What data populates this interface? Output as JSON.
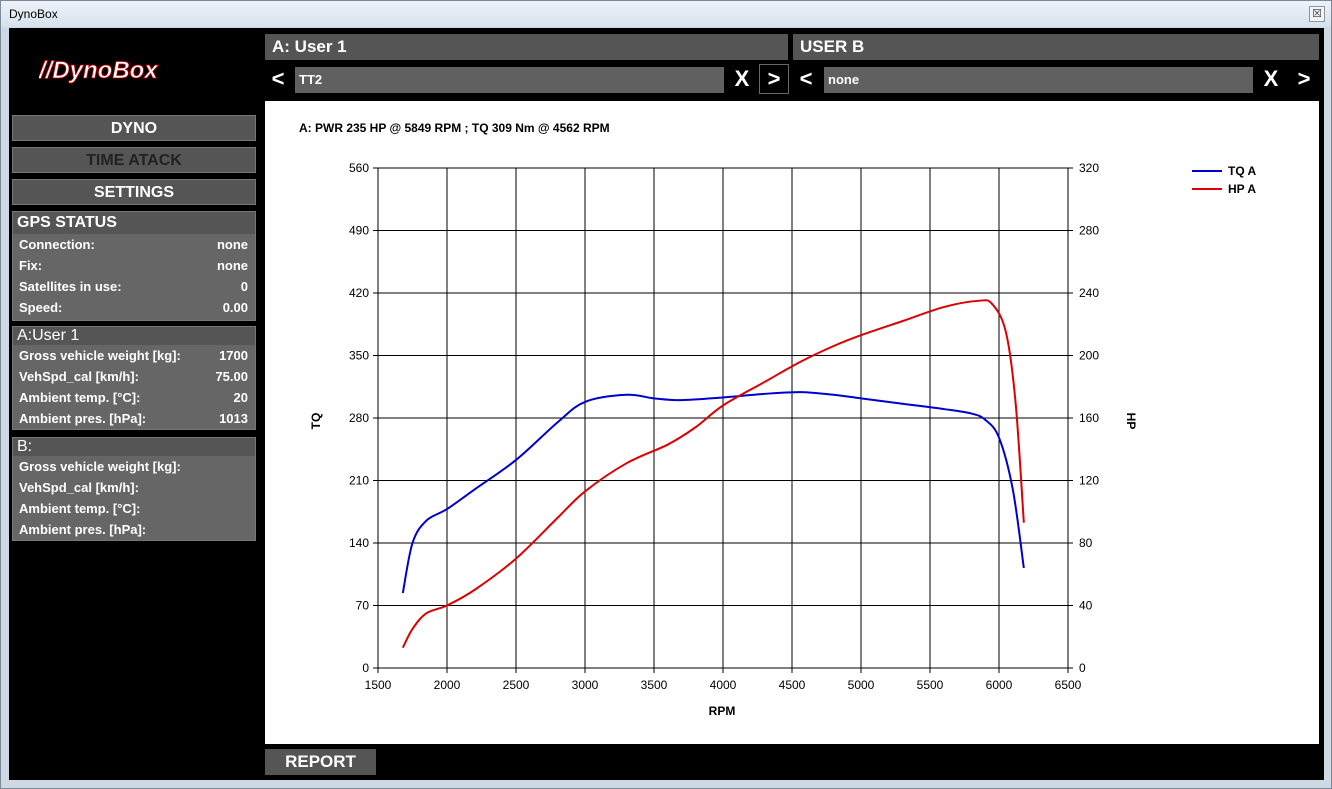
{
  "window": {
    "title": "DynoBox",
    "close_glyph": "☒"
  },
  "logo": {
    "text": "//DynoBox"
  },
  "sidebar": {
    "buttons": {
      "dyno": "DYNO",
      "time_attack": "TIME ATACK",
      "settings": "SETTINGS"
    },
    "gps": {
      "title": "GPS STATUS",
      "rows": [
        {
          "k": "Connection:",
          "v": "none"
        },
        {
          "k": "Fix:",
          "v": "none"
        },
        {
          "k": "Satellites in use:",
          "v": "0"
        },
        {
          "k": "Speed:",
          "v": "0.00"
        }
      ]
    },
    "user_a": {
      "title": "A:User 1",
      "rows": [
        {
          "k": "Gross vehicle weight [kg]:",
          "v": "1700"
        },
        {
          "k": "VehSpd_cal [km/h]:",
          "v": "75.00"
        },
        {
          "k": "Ambient temp. [°C]:",
          "v": "20"
        },
        {
          "k": "Ambient pres. [hPa]:",
          "v": "1013"
        }
      ]
    },
    "user_b": {
      "title": "B:",
      "rows": [
        {
          "k": "Gross vehicle weight [kg]:",
          "v": ""
        },
        {
          "k": "VehSpd_cal [km/h]:",
          "v": ""
        },
        {
          "k": "Ambient temp. [°C]:",
          "v": ""
        },
        {
          "k": "Ambient pres. [hPa]:",
          "v": ""
        }
      ]
    }
  },
  "top": {
    "a_header": "A: User 1",
    "b_header": "USER B",
    "a_select": "TT2",
    "b_select": "none",
    "prev": "<",
    "next": ">",
    "clear": "X"
  },
  "report_button": "REPORT",
  "chart_data": {
    "type": "line",
    "title": "A: PWR 235 HP @ 5849 RPM ; TQ 309 Nm @ 4562 RPM",
    "xlabel": "RPM",
    "ylabel_left": "TQ",
    "ylabel_right": "HP",
    "xlim": [
      1500,
      6500
    ],
    "xticks": [
      1500,
      2000,
      2500,
      3000,
      3500,
      4000,
      4500,
      5000,
      5500,
      6000,
      6500
    ],
    "ylim_left": [
      0,
      560
    ],
    "yticks_left": [
      0,
      70,
      140,
      210,
      280,
      350,
      420,
      490,
      560
    ],
    "ylim_right": [
      0,
      320
    ],
    "yticks_right": [
      0,
      40,
      80,
      120,
      160,
      200,
      240,
      280,
      320
    ],
    "grid": true,
    "legend_position": "top-right",
    "series": [
      {
        "name": "TQ A",
        "axis": "left",
        "color": "#0000cc",
        "points": [
          [
            1680,
            84
          ],
          [
            1750,
            140
          ],
          [
            1850,
            165
          ],
          [
            2000,
            178
          ],
          [
            2200,
            200
          ],
          [
            2500,
            233
          ],
          [
            2800,
            275
          ],
          [
            3000,
            298
          ],
          [
            3300,
            306
          ],
          [
            3500,
            302
          ],
          [
            3700,
            300
          ],
          [
            4000,
            303
          ],
          [
            4300,
            307
          ],
          [
            4562,
            309
          ],
          [
            4800,
            306
          ],
          [
            5000,
            302
          ],
          [
            5300,
            296
          ],
          [
            5600,
            290
          ],
          [
            5800,
            285
          ],
          [
            5900,
            278
          ],
          [
            6000,
            258
          ],
          [
            6100,
            200
          ],
          [
            6180,
            112
          ]
        ]
      },
      {
        "name": "HP A",
        "axis": "left",
        "color": "#dd0000",
        "points": [
          [
            1680,
            13
          ],
          [
            1750,
            25
          ],
          [
            1850,
            35
          ],
          [
            2000,
            40
          ],
          [
            2200,
            50
          ],
          [
            2500,
            70
          ],
          [
            2800,
            96
          ],
          [
            3000,
            113
          ],
          [
            3300,
            131
          ],
          [
            3600,
            143
          ],
          [
            3800,
            154
          ],
          [
            4000,
            168
          ],
          [
            4300,
            183
          ],
          [
            4562,
            196
          ],
          [
            4800,
            206
          ],
          [
            5000,
            213
          ],
          [
            5300,
            222
          ],
          [
            5600,
            231
          ],
          [
            5849,
            235
          ],
          [
            5950,
            233
          ],
          [
            6050,
            215
          ],
          [
            6120,
            170
          ],
          [
            6180,
            93
          ]
        ]
      }
    ]
  },
  "colors": {
    "panel": "#555555",
    "text": "#ffffff",
    "tq": "#0000cc",
    "hp": "#dd0000"
  }
}
